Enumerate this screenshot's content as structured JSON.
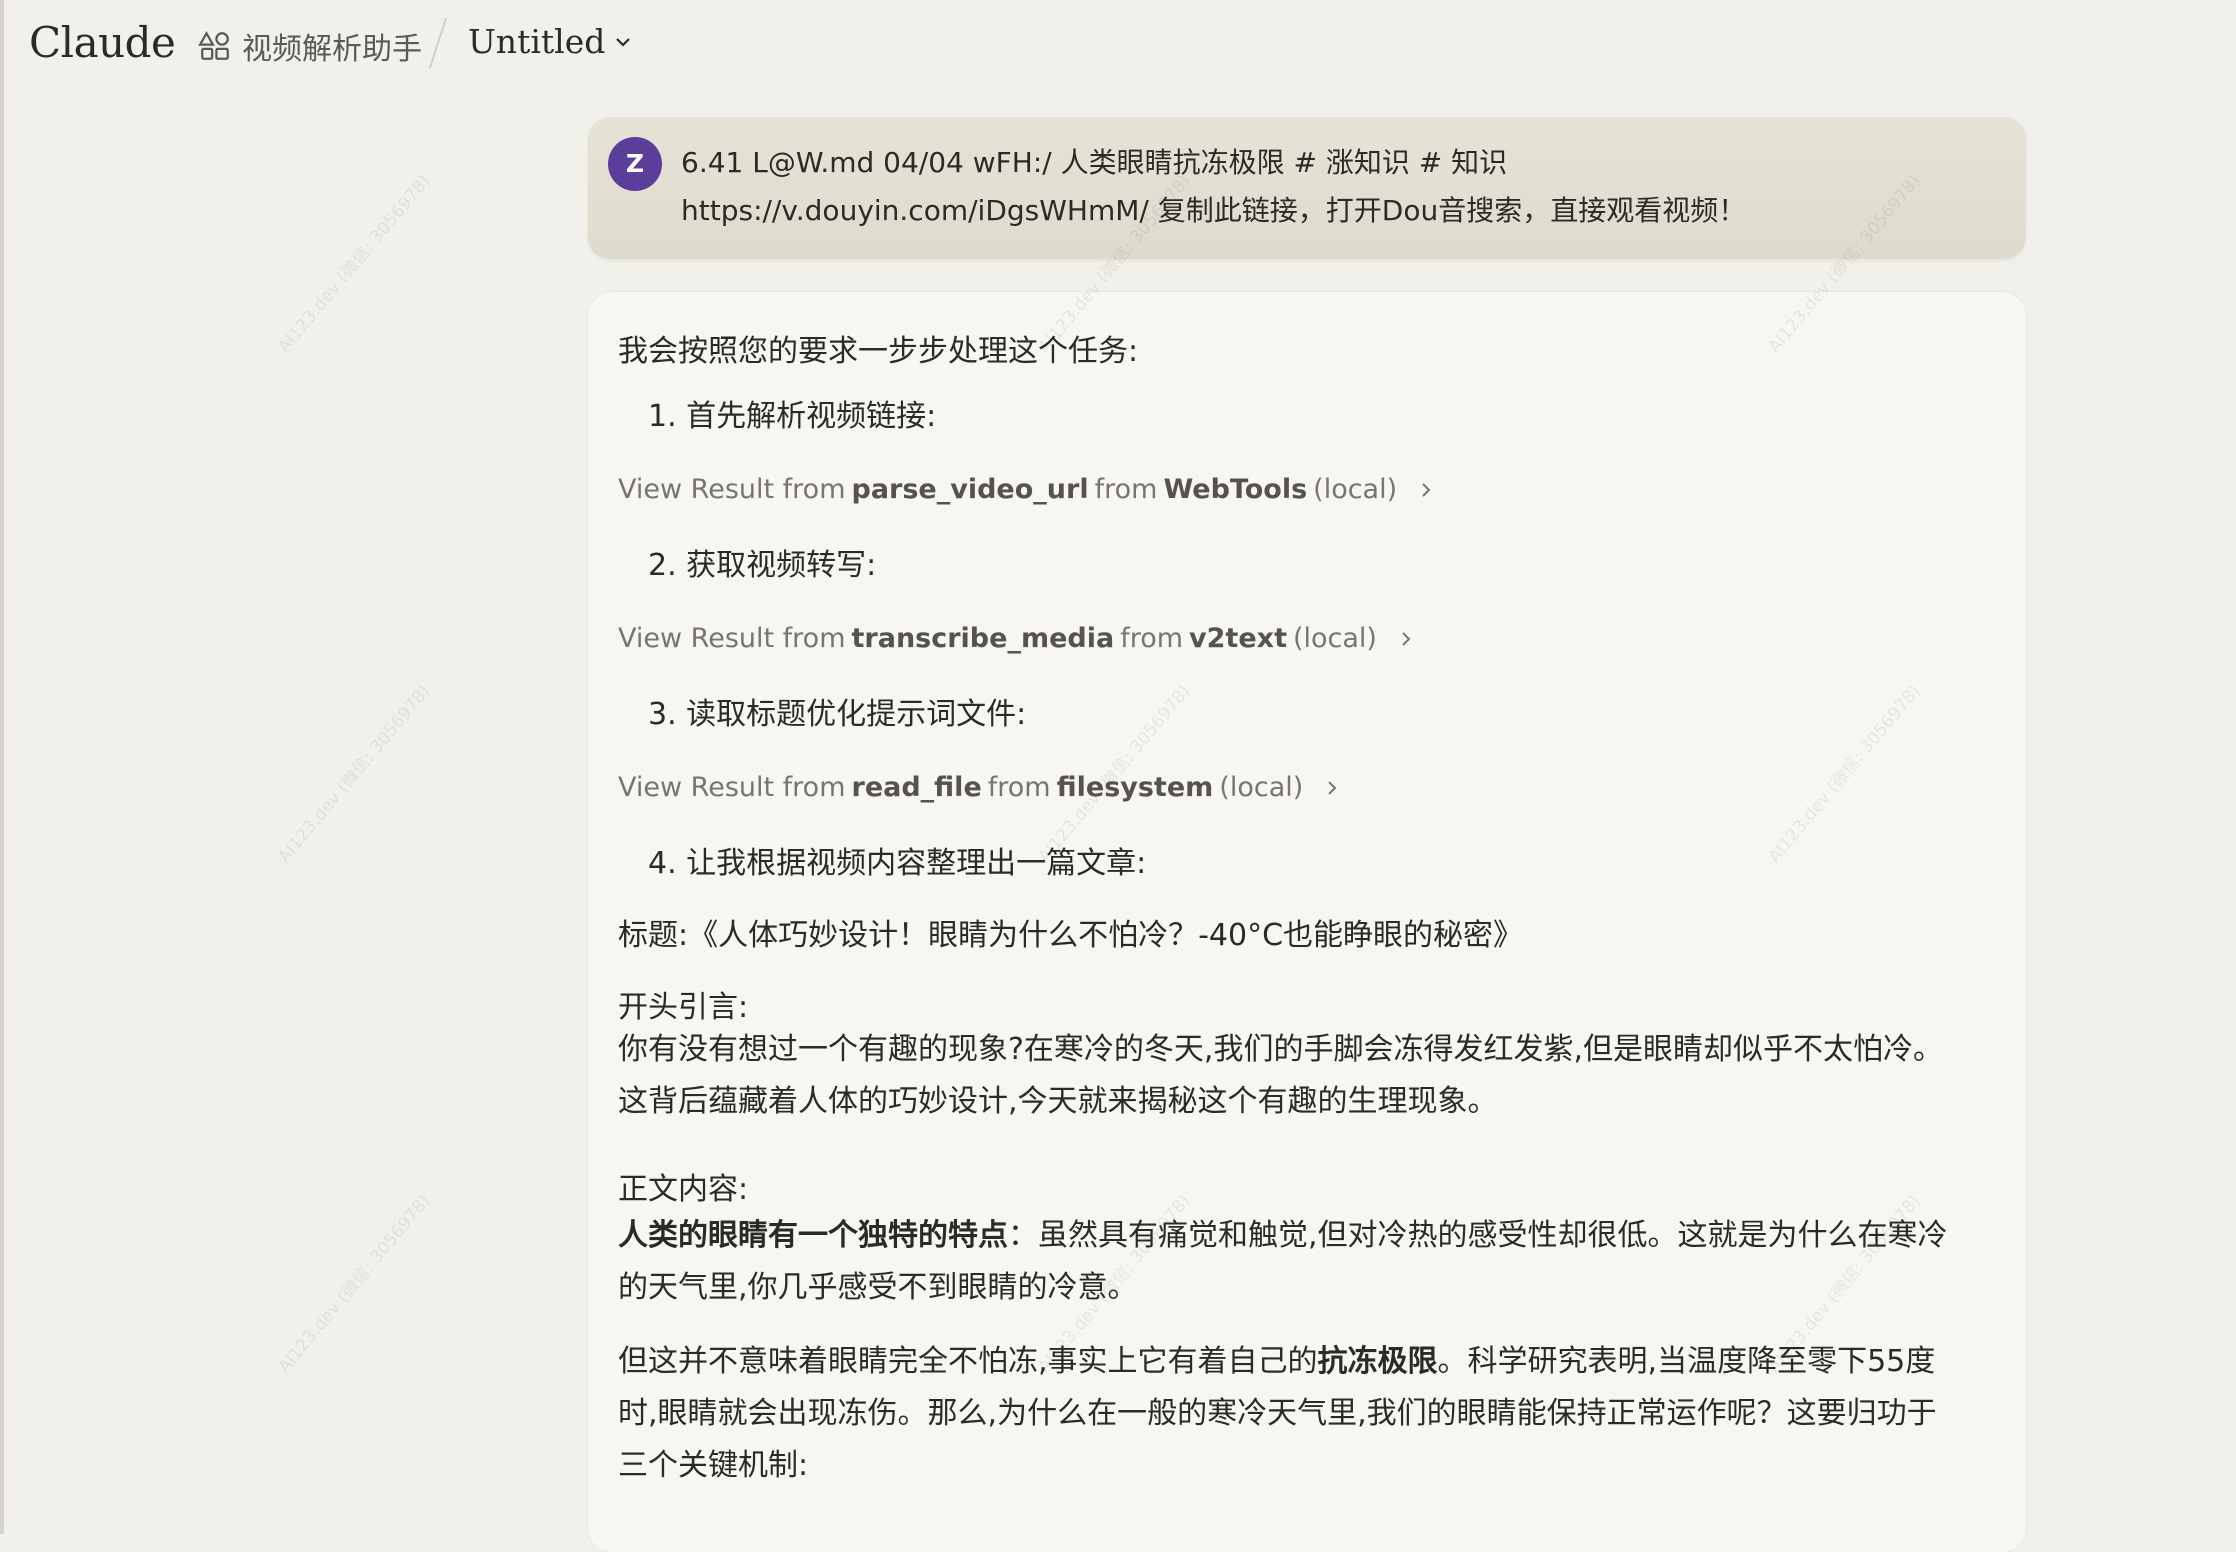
{
  "header": {
    "logo": "Claude",
    "project": "视频解析助手",
    "chat_title": "Untitled"
  },
  "user_message": {
    "avatar": "Z",
    "text": "6.41 L@W.md 04/04 wFH:/ 人类眼睛抗冻极限 # 涨知识 # 知识 https://v.douyin.com/iDgsWHmM/ 复制此链接，打开Dou音搜索，直接观看视频！"
  },
  "assistant": {
    "intro": "我会按照您的要求一步步处理这个任务:",
    "steps": [
      "1. 首先解析视频链接:",
      "2. 获取视频转写:",
      "3. 读取标题优化提示词文件:",
      "4. 让我根据视频内容整理出一篇文章:"
    ],
    "tool_results": [
      {
        "prefix": "View Result from",
        "tool": "parse_video_url",
        "mid": "from",
        "server": "WebTools",
        "suffix": "(local)"
      },
      {
        "prefix": "View Result from",
        "tool": "transcribe_media",
        "mid": "from",
        "server": "v2text",
        "suffix": "(local)"
      },
      {
        "prefix": "View Result from",
        "tool": "read_file",
        "mid": "from",
        "server": "filesystem",
        "suffix": "(local)"
      }
    ],
    "title_line": "标题:《人体巧妙设计！眼睛为什么不怕冷？-40°C也能睁眼的秘密》",
    "intro_heading": "开头引言:",
    "intro_para": "你有没有想过一个有趣的现象?在寒冷的冬天,我们的手脚会冻得发红发紫,但是眼睛却似乎不太怕冷。这背后蕴藏着人体的巧妙设计,今天就来揭秘这个有趣的生理现象。",
    "body_heading": "正文内容:",
    "p1_bold": "人类的眼睛有一个独特的特点",
    "p1_rest": "：虽然具有痛觉和触觉,但对冷热的感受性却很低。这就是为什么在寒冷的天气里,你几乎感受不到眼睛的冷意。",
    "p2_a": "但这并不意味着眼睛完全不怕冻,事实上它有着自己的",
    "p2_bold": "抗冻极限",
    "p2_b": "。科学研究表明,当温度降至零下55度时,眼睛就会出现冻伤。那么,为什么在一般的寒冷天气里,我们的眼睛能保持正常运作呢？这要归功于三个关键机制:"
  },
  "watermark": "AI123.dev (微信: 3056978)"
}
